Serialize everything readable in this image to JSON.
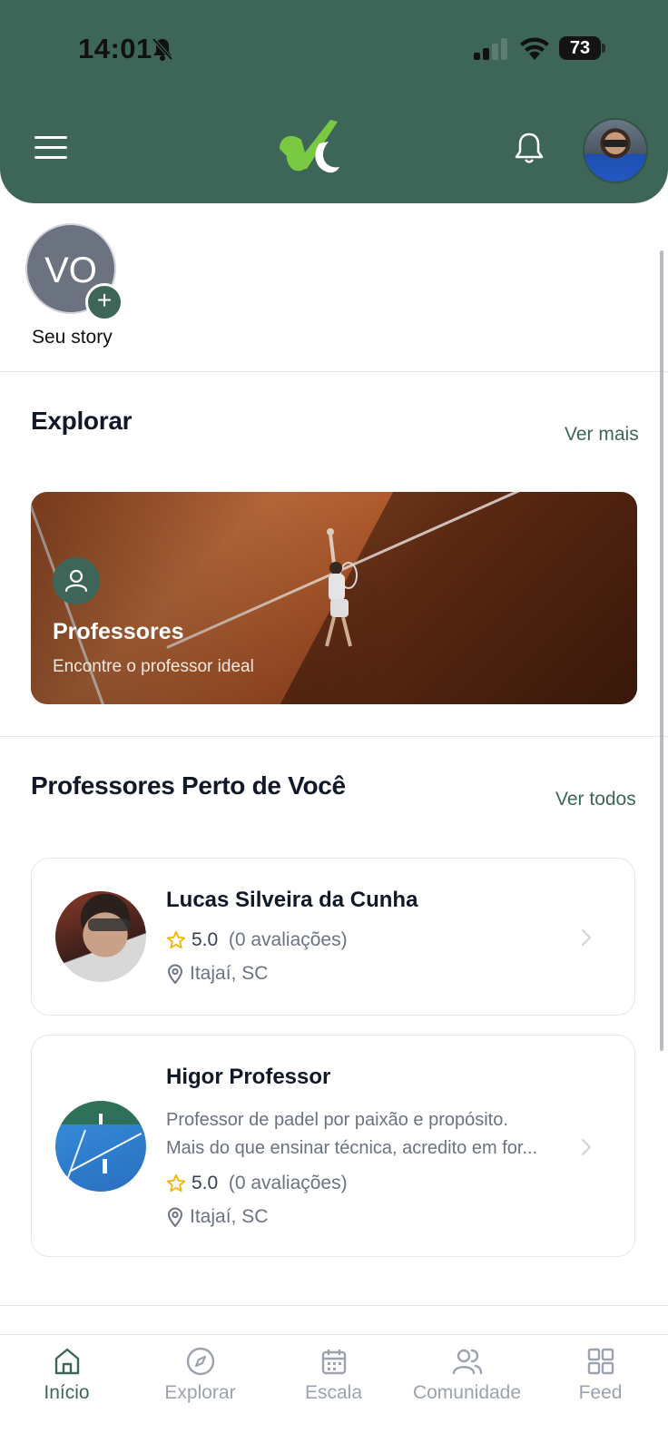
{
  "status_bar": {
    "time": "14:01",
    "battery": "73"
  },
  "header": {
    "logo": "logo-check"
  },
  "story": {
    "initials": "VO",
    "label": "Seu story"
  },
  "explore": {
    "title": "Explorar",
    "link": "Ver mais",
    "card": {
      "title": "Professores",
      "subtitle": "Encontre o professor ideal"
    }
  },
  "nearby": {
    "title": "Professores Perto de Você",
    "link": "Ver todos",
    "professors": [
      {
        "name": "Lucas Silveira da Cunha",
        "rating": "5.0",
        "reviews": "(0 avaliações)",
        "location": "Itajaí, SC"
      },
      {
        "name": "Higor Professor",
        "bio_line1": "Professor de padel por paixão e propósito.",
        "bio_line2": "Mais do que ensinar técnica, acredito em for...",
        "rating": "5.0",
        "reviews": "(0 avaliações)",
        "location": "Itajaí, SC"
      }
    ]
  },
  "tabs": [
    {
      "label": "Início",
      "icon": "home-icon",
      "active": true
    },
    {
      "label": "Explorar",
      "icon": "compass-icon",
      "active": false
    },
    {
      "label": "Escala",
      "icon": "calendar-icon",
      "active": false
    },
    {
      "label": "Comunidade",
      "icon": "users-icon",
      "active": false
    },
    {
      "label": "Feed",
      "icon": "grid-icon",
      "active": false
    }
  ],
  "colors": {
    "primary": "#3d6658",
    "accent": "#7ac943",
    "star": "#f4b400"
  }
}
